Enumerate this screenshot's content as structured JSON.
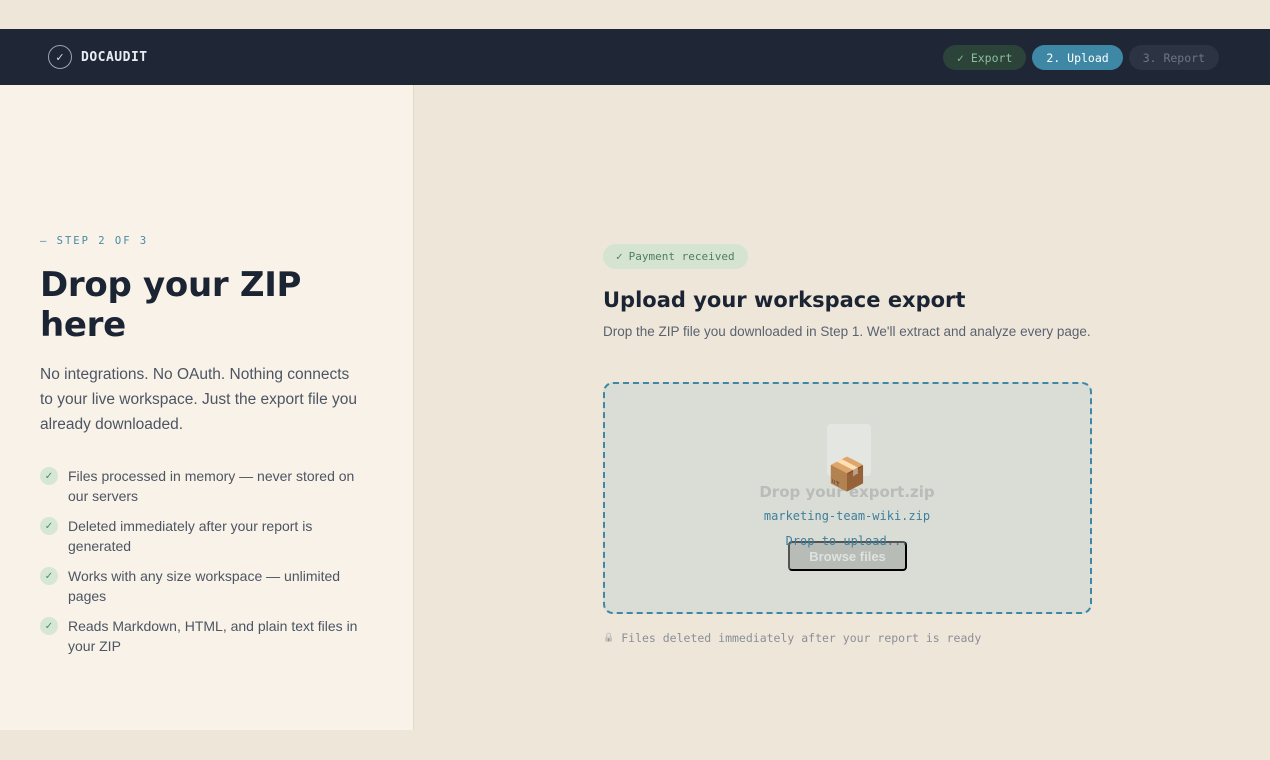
{
  "topbar": {
    "brand_icon": "check-circle-icon",
    "brand_glyph": "✓",
    "brand_name": "DOCAUDIT",
    "steps": [
      {
        "label": "✓ Export",
        "state": "done"
      },
      {
        "label": "2. Upload",
        "state": "active"
      },
      {
        "label": "3. Report",
        "state": "todo"
      }
    ]
  },
  "left": {
    "eyebrow": "— STEP 2 OF 3",
    "headline": "Drop your ZIP here",
    "intro": "No integrations. No OAuth. Nothing connects to your live workspace. Just the export file you already downloaded.",
    "features": [
      "Files processed in memory — never stored on our servers",
      "Deleted immediately after your report is generated",
      "Works with any size workspace — unlimited pages",
      "Reads Markdown, HTML, and plain text files in your ZIP"
    ],
    "feature_icon": "check-icon",
    "feature_glyph": "✓"
  },
  "main": {
    "badge": {
      "glyph": "✓",
      "label": "Payment received"
    },
    "title": "Upload your workspace export",
    "subtitle": "Drop the ZIP file you downloaded in Step 1. We'll extract and analyze every page.",
    "dropzone": {
      "icon": "package-box-icon",
      "icon_glyph": "📦",
      "title": "Drop your export.zip",
      "filename": "marketing-team-wiki.zip",
      "browse_label": "Browse files",
      "status": "Drop to upload..."
    },
    "note": {
      "icon": "lock-icon",
      "glyph": "🔒",
      "text": "Files deleted immediately after your report is ready"
    }
  },
  "colors": {
    "page_bg": "#efe6da",
    "topbar_bg": "#1f2736",
    "accent": "#3e88a5",
    "left_panel_bg": "#f8f2e8",
    "dropzone_bg": "#d9ddd6",
    "success": "#4e7f5a"
  }
}
